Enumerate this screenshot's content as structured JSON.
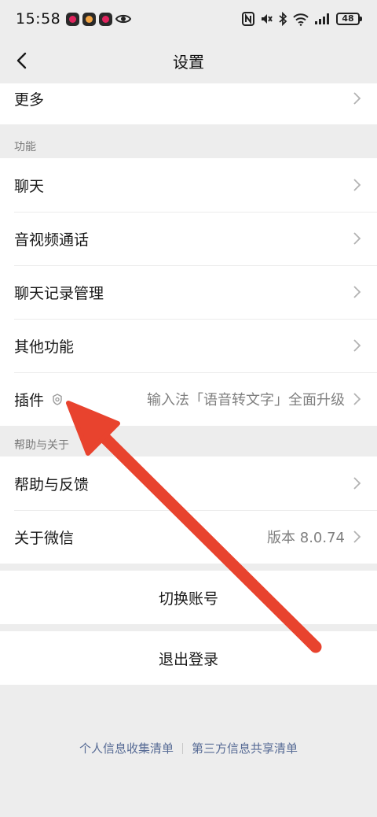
{
  "status_bar": {
    "time": "15:58",
    "battery": "48"
  },
  "nav": {
    "title": "设置"
  },
  "rows_top": [
    {
      "label": "更多"
    }
  ],
  "sections": {
    "functions": {
      "header": "功能",
      "items": [
        {
          "label": "聊天"
        },
        {
          "label": "音视频通话"
        },
        {
          "label": "聊天记录管理"
        },
        {
          "label": "其他功能"
        },
        {
          "label": "插件",
          "value": "输入法「语音转文字」全面升级"
        }
      ]
    },
    "help": {
      "header": "帮助与关于",
      "items": [
        {
          "label": "帮助与反馈"
        },
        {
          "label": "关于微信",
          "value": "版本 8.0.74"
        }
      ]
    }
  },
  "actions": {
    "switch_account": "切换账号",
    "logout": "退出登录"
  },
  "footer": {
    "personal_info": "个人信息收集清单",
    "third_party": "第三方信息共享清单"
  },
  "colors": {
    "background": "#ededed",
    "link": "#576b95",
    "annotation_arrow": "#e8432e"
  },
  "icons": [
    "back-icon",
    "chevron-right-icon",
    "plugin-badge-icon",
    "nfc-icon",
    "mute-icon",
    "bluetooth-icon",
    "wifi-icon",
    "signal-icon",
    "battery-icon",
    "eye-icon"
  ]
}
